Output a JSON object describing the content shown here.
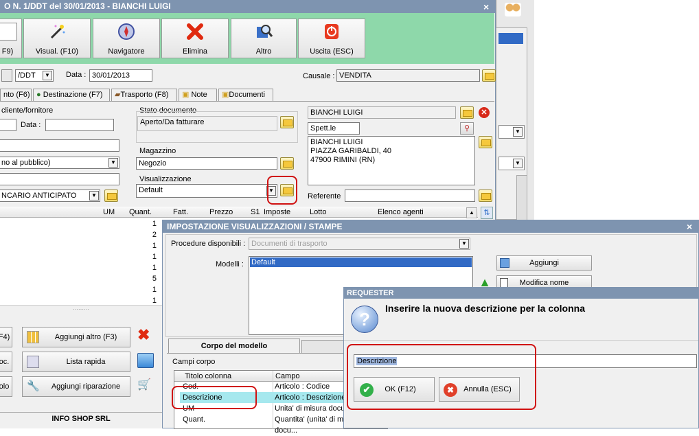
{
  "main_window": {
    "title": "O N. 1/DDT del 30/01/2013 - BIANCHI LUIGI",
    "close": "×",
    "toolbar": [
      {
        "label": "F9)",
        "icon": "document-icon"
      },
      {
        "label": "Visual. (F10)",
        "icon": "magic-wand-icon"
      },
      {
        "label": "Navigatore",
        "icon": "compass-icon"
      },
      {
        "label": "Elimina",
        "icon": "delete-x-icon"
      },
      {
        "label": "Altro",
        "icon": "search-book-icon"
      },
      {
        "label": "Uscita (ESC)",
        "icon": "power-icon"
      }
    ],
    "doc_type": "/DDT",
    "date_label": "Data :",
    "date_value": "30/01/2013",
    "causale_label": "Causale :",
    "causale_value": "VENDITA",
    "tabs": [
      "nto (F6)",
      "Destinazione (F7)",
      "Trasporto (F8)",
      "Note",
      "Documenti"
    ],
    "cliente_label": "cliente/fornitore",
    "data_label2": "Data :",
    "listino_value": "no al pubblico)",
    "pagamento_value": "NCARIO ANTICIPATO",
    "stato_label": "Stato documento",
    "stato_value": "Aperto/Da fatturare",
    "magazzino_label": "Magazzino",
    "magazzino_value": "Negozio",
    "visualizzazione_label": "Visualizzazione",
    "visualizzazione_value": "Default",
    "cliente_nome": "BIANCHI LUIGI",
    "spett": "Spett.le",
    "indirizzo": [
      "BIANCHI LUIGI",
      "PIAZZA GARIBALDI, 40",
      "47900 RIMINI (RN)"
    ],
    "referente_label": "Referente",
    "grid_headers": [
      "UM",
      "Quant.",
      "Fatt.",
      "Prezzo",
      "S1",
      "Imposte",
      "Lotto",
      "Elenco agenti"
    ],
    "quantities": [
      "1",
      "2",
      "1",
      "1",
      "1",
      "5",
      "1",
      "1"
    ],
    "bottom_buttons": [
      {
        "left": "F4)",
        "right": "Aggiungi altro (F3)"
      },
      {
        "left": "oc.",
        "right": "Lista rapida"
      },
      {
        "left": "olo",
        "right": "Aggiungi riparazione"
      }
    ],
    "company": "INFO SHOP SRL"
  },
  "impostazione_window": {
    "title": "IMPOSTAZIONE VISUALIZZAZIONI / STAMPE",
    "close": "×",
    "procedure_label": "Procedure disponibili :",
    "procedure_value": "Documenti di trasporto",
    "modelli_label": "Modelli :",
    "modelli_items": [
      "Default"
    ],
    "aggiungi": "Aggiungi",
    "modifica_nome": "Modifica nome",
    "tab_corpo": "Corpo del modello",
    "campi_corpo": "Campi corpo",
    "col_headers": [
      "Titolo colonna",
      "Campo"
    ],
    "rows": [
      {
        "titolo": "Cod.",
        "campo": "Articolo : Codice"
      },
      {
        "titolo": "Descrizione",
        "campo": "Articolo : Descrizione"
      },
      {
        "titolo": "UM",
        "campo": "Unita' di misura docum"
      },
      {
        "titolo": "Quant.",
        "campo": "Quantita' (unita' di misura docu..."
      }
    ]
  },
  "requester": {
    "title": "REQUESTER",
    "question": "Inserire la nuova descrizione per la colonna",
    "input_value": "Descrizione",
    "ok": "OK (F12)",
    "annulla": "Annulla (ESC)"
  },
  "colors": {
    "title_bar": "#7e94b0",
    "toolbar_bg": "#8ed8aa",
    "highlight_ring": "#d01010",
    "selection": "#316ac5",
    "row_highlight": "#a6e8ee"
  }
}
